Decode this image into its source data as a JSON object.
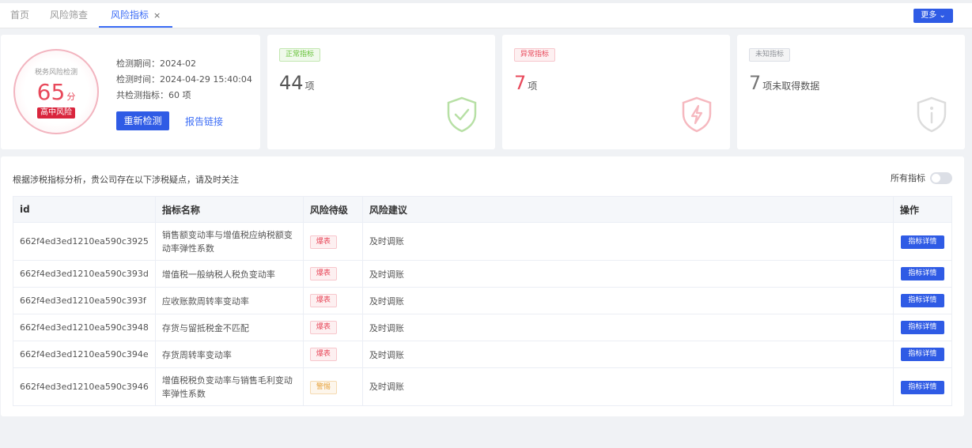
{
  "tabs": [
    {
      "label": "首页"
    },
    {
      "label": "风险筛查"
    },
    {
      "label": "风险指标",
      "close": "×"
    }
  ],
  "more_button": "更多 ⌄",
  "score": {
    "title": "税务风险检测",
    "value": "65",
    "unit": "分",
    "level": "高中风险",
    "color": "#e8495b"
  },
  "detection": {
    "period": "检测期间：2024-02",
    "time": "检测时间：2024-04-29 15:40:04",
    "total": "共检测指标：60 项",
    "recheck_label": "重新检测",
    "report_label": "报告链接"
  },
  "stats": [
    {
      "tag": "正常指标",
      "num": "44",
      "suffix": "项",
      "color": "#67c23a",
      "icon": "shield-check-icon"
    },
    {
      "tag": "异常指标",
      "num": "7",
      "suffix": "项",
      "color": "#e8495b",
      "icon": "shield-bolt-icon"
    },
    {
      "tag": "未知指标",
      "num": "7",
      "suffix": "项未取得数据",
      "color": "#909399",
      "icon": "shield-info-icon"
    }
  ],
  "main": {
    "description": "根据涉税指标分析，贵公司存在以下涉税疑点，请及时关注",
    "toggle_label": "所有指标"
  },
  "table": {
    "headers": [
      "id",
      "指标名称",
      "风险待级",
      "风险建议",
      "操作"
    ],
    "rows": [
      {
        "id": "662f4ed3ed1210ea590c3925",
        "name": "销售额变动率与增值税应纳税额变动率弹性系数",
        "level": "爆表",
        "type": "danger",
        "advice": "及时调账",
        "action": "指标详情"
      },
      {
        "id": "662f4ed3ed1210ea590c393d",
        "name": "增值税一般纳税人税负变动率",
        "level": "爆表",
        "type": "danger",
        "advice": "及时调账",
        "action": "指标详情"
      },
      {
        "id": "662f4ed3ed1210ea590c393f",
        "name": "应收账款周转率变动率",
        "level": "爆表",
        "type": "danger",
        "advice": "及时调账",
        "action": "指标详情"
      },
      {
        "id": "662f4ed3ed1210ea590c3948",
        "name": "存货与留抵税金不匹配",
        "level": "爆表",
        "type": "danger",
        "advice": "及时调账",
        "action": "指标详情"
      },
      {
        "id": "662f4ed3ed1210ea590c394e",
        "name": "存货周转率变动率",
        "level": "爆表",
        "type": "danger",
        "advice": "及时调账",
        "action": "指标详情"
      },
      {
        "id": "662f4ed3ed1210ea590c3946",
        "name": "增值税税负变动率与销售毛利变动率弹性系数",
        "level": "警惕",
        "type": "warn",
        "advice": "及时调账",
        "action": "指标详情"
      }
    ]
  }
}
